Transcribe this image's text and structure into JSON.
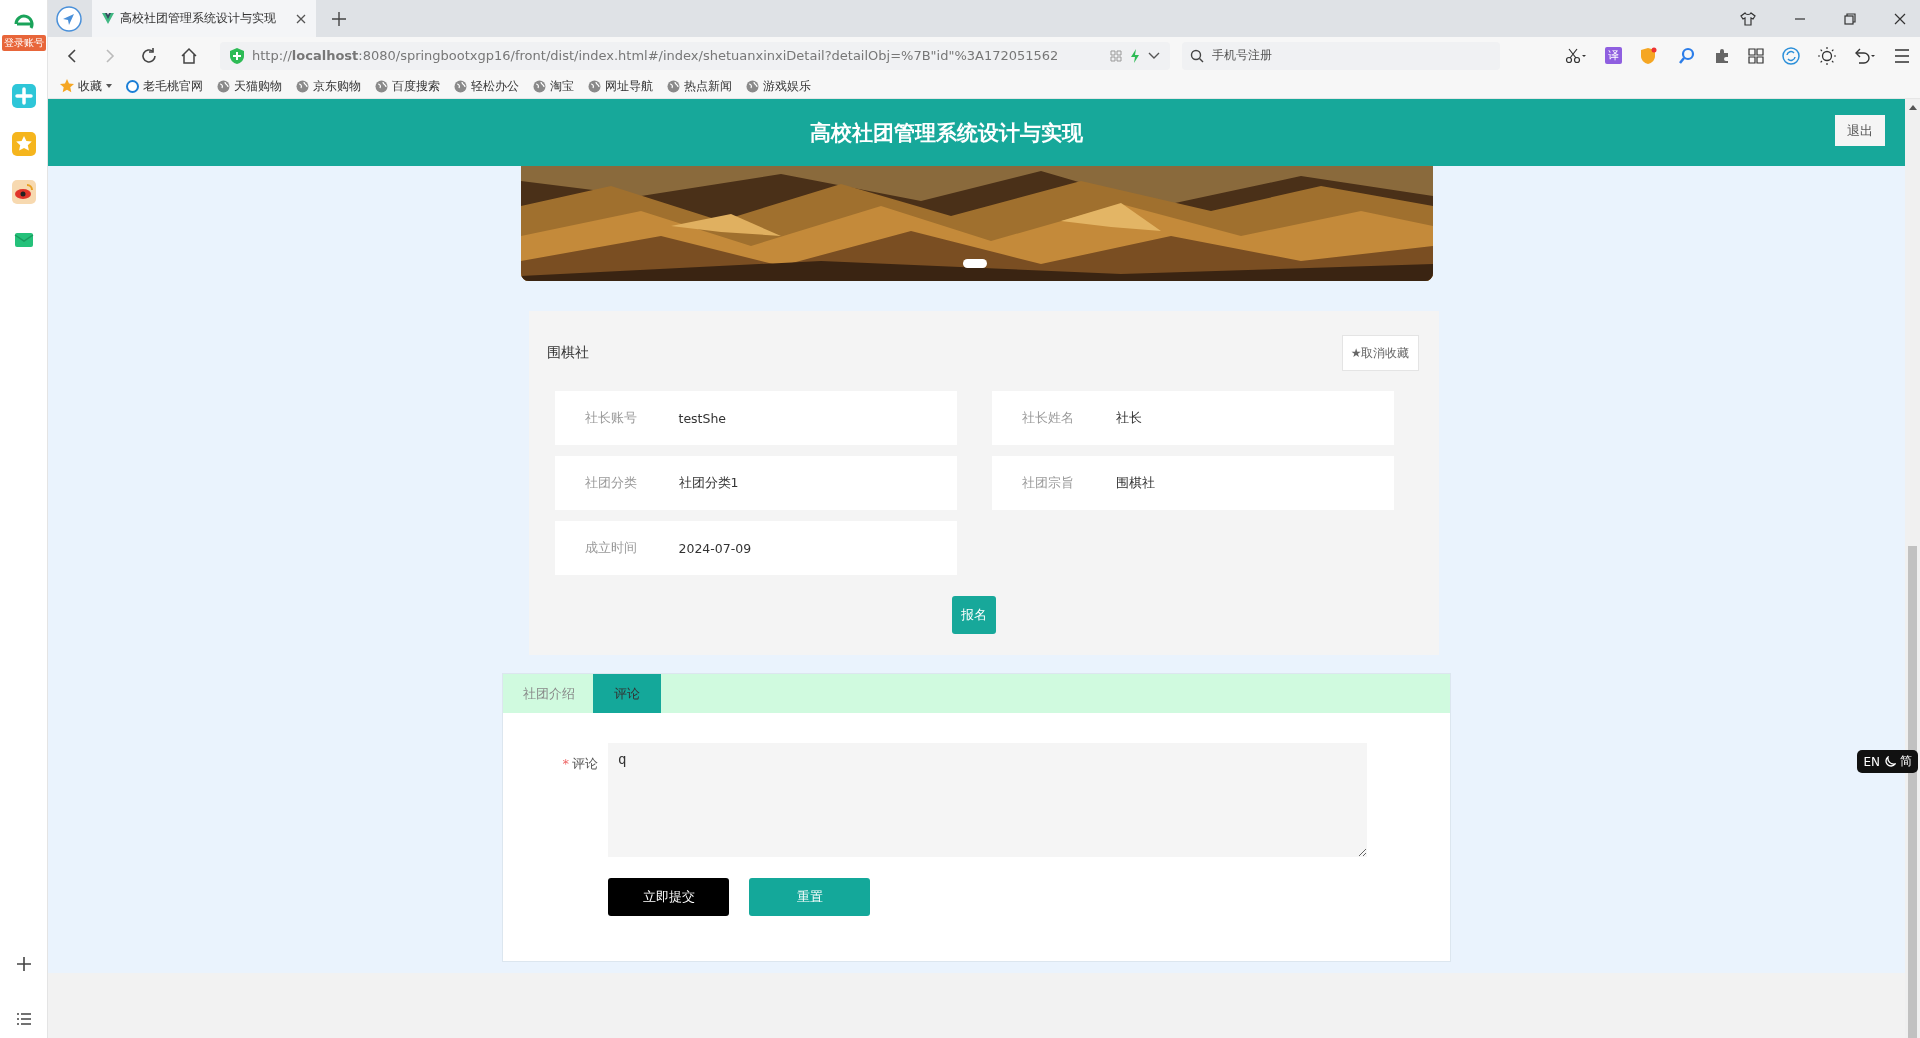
{
  "browser": {
    "sidebar_badge": "登录账号",
    "tabs": [
      {
        "title": "高校社团管理系统设计与实现",
        "selected": true
      }
    ],
    "url": "http://**localhost**:8080/springbootxgp16/front/dist/index.html#/index/shetuanxinxiDetail?detailObj=%7B\"id\"%3A172051562",
    "search_placeholder": "手机号注册",
    "translate_badge": "译",
    "bookmarks": [
      {
        "label": "收藏",
        "kind": "folder"
      },
      {
        "label": "老毛桃官网",
        "kind": "site"
      },
      {
        "label": "天猫购物",
        "kind": "link"
      },
      {
        "label": "京东购物",
        "kind": "link"
      },
      {
        "label": "百度搜索",
        "kind": "link"
      },
      {
        "label": "轻松办公",
        "kind": "link"
      },
      {
        "label": "淘宝",
        "kind": "link"
      },
      {
        "label": "网址导航",
        "kind": "link"
      },
      {
        "label": "热点新闻",
        "kind": "link"
      },
      {
        "label": "游戏娱乐",
        "kind": "link"
      }
    ]
  },
  "header": {
    "title": "高校社团管理系统设计与实现",
    "logout_button": "退出"
  },
  "club": {
    "name": "围棋社",
    "favorite_button": "★取消收藏",
    "fields": [
      {
        "label": "社长账号",
        "value": "testShe"
      },
      {
        "label": "社长姓名",
        "value": "社长"
      },
      {
        "label": "社团分类",
        "value": "社团分类1"
      },
      {
        "label": "社团宗旨",
        "value": "围棋社"
      },
      {
        "label": "成立时间",
        "value": "2024-07-09"
      }
    ],
    "signup_button": "报名"
  },
  "tabs": [
    {
      "label": "社团介绍",
      "selected": false
    },
    {
      "label": "评论",
      "selected": true
    }
  ],
  "comment_form": {
    "label": "评论",
    "required_mark": "*",
    "value": "q",
    "buttons": [
      {
        "label": "立即提交",
        "kind": "submit"
      },
      {
        "label": "重置",
        "kind": "reset"
      }
    ]
  },
  "ime": {
    "mode": "EN",
    "script": "简"
  }
}
